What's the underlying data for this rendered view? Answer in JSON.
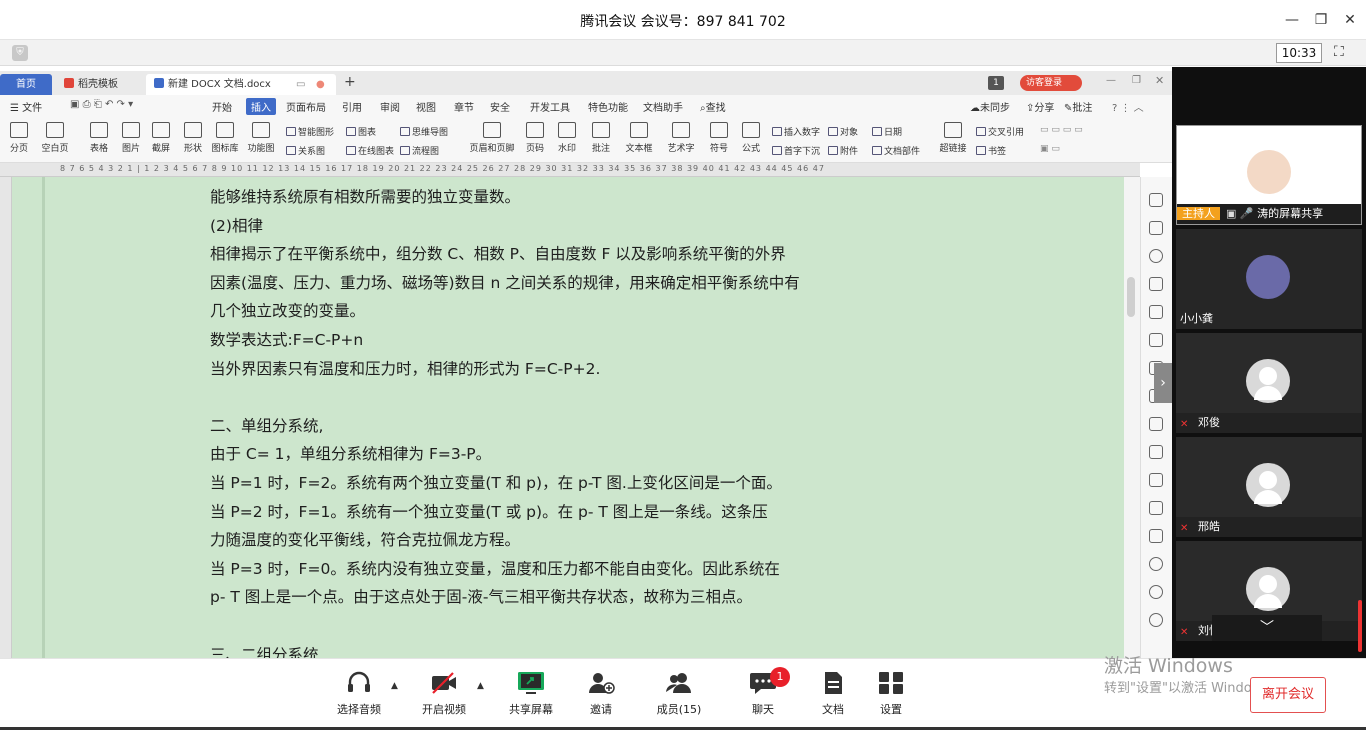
{
  "meeting": {
    "title": "腾讯会议 会议号：897 841 702",
    "time": "10:33"
  },
  "wps": {
    "tabs": [
      {
        "label": "首页"
      },
      {
        "label": "稻壳模板"
      },
      {
        "label": "新建 DOCX 文档.docx"
      }
    ],
    "login_label": "访客登录",
    "menu": [
      "文件",
      "开始",
      "插入",
      "页面布局",
      "引用",
      "审阅",
      "视图",
      "章节",
      "安全",
      "开发工具",
      "特色功能",
      "文档助手",
      "查找"
    ],
    "menu_right": [
      "未同步",
      "分享",
      "批注"
    ],
    "ribbon": {
      "big": [
        "分页",
        "空白页",
        "表格",
        "图片",
        "截屏",
        "形状",
        "图标库",
        "功能图",
        "页眉和页脚",
        "页码",
        "水印",
        "批注",
        "文本框",
        "艺术字",
        "符号",
        "公式",
        "超链接"
      ],
      "small": [
        "智能图形",
        "图表",
        "思维导图",
        "关系图",
        "在线图表",
        "流程图",
        "插入数字",
        "对象",
        "日期",
        "首字下沉",
        "附件",
        "文档部件",
        "交叉引用",
        "书签"
      ]
    },
    "ruler_scale": "8 7 6 5 4 3 2 1 | 1 2 3 4 5 6 7 8 9 10 11 12 13 14 15 16 17 18 19 20 21 22 23 24 25 26 27 28 29 30 31 32 33 34 35 36 37 38 39 40 41 42 43 44 45 46 47"
  },
  "document": {
    "lines": [
      "能够维持系统原有相数所需要的独立变量数。",
      "(2)相律",
      "相律揭示了在平衡系统中，组分数 C、相数 P、自由度数 F 以及影响系统平衡的外界",
      "因素(温度、压力、重力场、磁场等)数目 n 之间关系的规律，用来确定相平衡系统中有",
      "几个独立改变的变量。",
      "数学表达式:F=C-P+n",
      "当外界因素只有温度和压力时，相律的形式为 F=C-P+2.",
      "",
      "二、单组分系统,",
      "由于 C= 1，单组分系统相律为 F=3-P。",
      "当 P=1 时，F=2。系统有两个独立变量(T 和 p)，在 p-T 图.上变化区间是一个面。",
      "当 P=2 时，F=1。系统有一个独立变量(T 或 p)。在 p- T 图上是一条线。这条压",
      "力随温度的变化平衡线，符合克拉佩龙方程。",
      "当 P=3 时，F=0。系统内没有独立变量，温度和压力都不能自由变化。因此系统在",
      "p- T 图上是一个点。由于这点处于固-液-气三相平衡共存状态，故称为三相点。",
      "",
      "三、二组分系统"
    ]
  },
  "participants": [
    {
      "name": "涛的屏幕共享",
      "role": "主持人"
    },
    {
      "name": "小小龚"
    },
    {
      "name": "邓俊"
    },
    {
      "name": "邢皓"
    },
    {
      "name": "刘恒一"
    }
  ],
  "toolbar": {
    "audio": "选择音频",
    "video": "开启视频",
    "share": "共享屏幕",
    "invite": "邀请",
    "members": "成员(15)",
    "chat": "聊天",
    "chat_badge": "1",
    "docs": "文档",
    "settings": "设置",
    "leave": "离开会议"
  },
  "watermark": {
    "line1": "激活 Windows",
    "line2": "转到\"设置\"以激活 Windows。"
  }
}
